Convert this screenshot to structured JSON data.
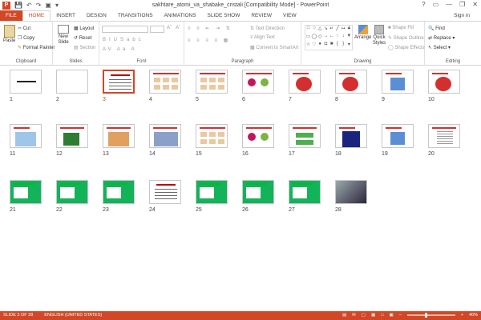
{
  "app": {
    "logo": "P",
    "title": "sakhtare_atomi_va_shabake_cristali [Compatibility Mode] - PowerPoint",
    "sign_in": "Sign in",
    "qat_icons": [
      "save-icon",
      "undo-icon",
      "redo-icon",
      "slideshow-icon",
      "customize-icon"
    ],
    "window_controls": [
      "?",
      "▭",
      "—",
      "❐",
      "✕"
    ]
  },
  "tabs": [
    "FILE",
    "HOME",
    "INSERT",
    "DESIGN",
    "TRANSITIONS",
    "ANIMATIONS",
    "SLIDE SHOW",
    "REVIEW",
    "VIEW"
  ],
  "active_tab": "HOME",
  "ribbon": {
    "clipboard": {
      "label": "Clipboard",
      "paste": "Paste",
      "cut": "Cut",
      "copy": "Copy",
      "format_painter": "Format Painter"
    },
    "slides": {
      "label": "Slides",
      "new_slide": "New Slide",
      "layout": "Layout",
      "reset": "Reset",
      "section": "Section"
    },
    "font": {
      "label": "Font"
    },
    "paragraph": {
      "label": "Paragraph",
      "text_direction": "Text Direction",
      "align_text": "Align Text",
      "convert_smartart": "Convert to SmartArt"
    },
    "drawing": {
      "label": "Drawing",
      "arrange": "Arrange",
      "quick_styles": "Quick Styles",
      "shape_fill": "Shape Fill",
      "shape_outline": "Shape Outline",
      "shape_effects": "Shape Effects"
    },
    "editing": {
      "label": "Editing",
      "find": "Find",
      "replace": "Replace",
      "select": "Select"
    }
  },
  "slides": [
    {
      "n": "1",
      "bg": "#ffffff",
      "kind": "title"
    },
    {
      "n": "2",
      "bg": "#ffffff",
      "kind": "blank"
    },
    {
      "n": "3",
      "bg": "#ffffff",
      "kind": "text",
      "selected": true
    },
    {
      "n": "4",
      "bg": "#ffffff",
      "kind": "grid"
    },
    {
      "n": "5",
      "bg": "#ffffff",
      "kind": "grid"
    },
    {
      "n": "6",
      "bg": "#ffffff",
      "kind": "crystal"
    },
    {
      "n": "7",
      "bg": "#ffffff",
      "kind": "red"
    },
    {
      "n": "8",
      "bg": "#ffffff",
      "kind": "red"
    },
    {
      "n": "9",
      "bg": "#ffffff",
      "kind": "blue"
    },
    {
      "n": "10",
      "bg": "#ffffff",
      "kind": "red"
    },
    {
      "n": "11",
      "bg": "#ffffff",
      "kind": "cube"
    },
    {
      "n": "12",
      "bg": "#ffffff",
      "kind": "green"
    },
    {
      "n": "13",
      "bg": "#ffffff",
      "kind": "orange"
    },
    {
      "n": "14",
      "bg": "#ffffff",
      "kind": "lattice"
    },
    {
      "n": "15",
      "bg": "#ffffff",
      "kind": "grid"
    },
    {
      "n": "16",
      "bg": "#ffffff",
      "kind": "crystal"
    },
    {
      "n": "17",
      "bg": "#ffffff",
      "kind": "planes"
    },
    {
      "n": "18",
      "bg": "#ffffff",
      "kind": "dark"
    },
    {
      "n": "19",
      "bg": "#ffffff",
      "kind": "blue"
    },
    {
      "n": "20",
      "bg": "#ffffff",
      "kind": "table"
    },
    {
      "n": "21",
      "bg": "#13b35a",
      "kind": "greenbg"
    },
    {
      "n": "22",
      "bg": "#13b35a",
      "kind": "greenbg"
    },
    {
      "n": "23",
      "bg": "#13b35a",
      "kind": "greenbg"
    },
    {
      "n": "24",
      "bg": "#ffffff",
      "kind": "text"
    },
    {
      "n": "25",
      "bg": "#13b35a",
      "kind": "greenbg"
    },
    {
      "n": "26",
      "bg": "#13b35a",
      "kind": "greenbg"
    },
    {
      "n": "27",
      "bg": "#13b35a",
      "kind": "greenbg"
    },
    {
      "n": "28",
      "bg": "#dddddd",
      "kind": "photo"
    }
  ],
  "status": {
    "slide_of": "SLIDE 3 OF 28",
    "language": "ENGLISH (UNITED STATES)",
    "zoom": "40%"
  },
  "colors": {
    "accent": "#d24726",
    "green_slide": "#13b35a"
  }
}
